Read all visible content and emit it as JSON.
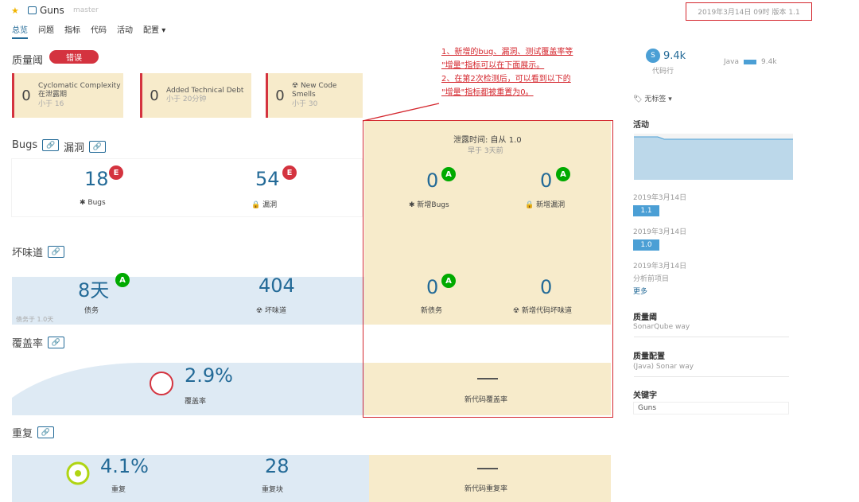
{
  "header": {
    "project": "Guns",
    "branch": "master",
    "date_version": "2019年3月14日 09时 版本 1.1"
  },
  "nav": {
    "tabs": [
      "总览",
      "问题",
      "指标",
      "代码",
      "活动",
      "配置"
    ]
  },
  "quality_gate": {
    "title": "质量阈",
    "status": "错误",
    "conditions": [
      {
        "value": "0",
        "name": "Cyclomatic Complexity",
        "name2": "在泄露期",
        "threshold": "小于 16"
      },
      {
        "value": "0",
        "name": "Added Technical Debt",
        "name2": "",
        "threshold": "小于 20分钟"
      },
      {
        "value": "0",
        "name": "New Code Smells",
        "name2": "",
        "threshold": "小于 30"
      }
    ]
  },
  "annotation": {
    "line1": "1、新增的bug、漏洞、测试覆盖率等",
    "line2": "\"增量\"指标可以在下面展示。",
    "line3": "2、在第2次检测后，可以看到以下的",
    "line4": "\"增量\"指标都被重置为0。"
  },
  "leak": {
    "title": "泄露时间: 自从 1.0",
    "subtitle": "早于 3天前"
  },
  "bugs_section": {
    "title": "Bugs",
    "title2": "漏洞",
    "bugs_value": "18",
    "bugs_rating": "E",
    "bugs_label": "Bugs",
    "vuln_value": "54",
    "vuln_rating": "E",
    "vuln_label": "漏洞",
    "new_bugs_value": "0",
    "new_bugs_rating": "A",
    "new_bugs_label": "新增Bugs",
    "new_vuln_value": "0",
    "new_vuln_rating": "A",
    "new_vuln_label": "新增漏洞"
  },
  "smells_section": {
    "title": "坏味道",
    "debt_value": "8天",
    "debt_rating": "A",
    "debt_label": "债务",
    "debt_note": "债务于 1.0天",
    "smells_value": "404",
    "smells_label": "坏味道",
    "new_debt_value": "0",
    "new_debt_rating": "A",
    "new_debt_label": "新债务",
    "new_smells_value": "0",
    "new_smells_label": "新增代码坏味道"
  },
  "coverage_section": {
    "title": "覆盖率",
    "coverage_value": "2.9%",
    "coverage_label": "覆盖率",
    "new_coverage_value": "—",
    "new_coverage_label": "新代码覆盖率"
  },
  "dup_section": {
    "title": "重复",
    "dup_value": "4.1%",
    "dup_label": "重复",
    "blocks_value": "28",
    "blocks_label": "重复块",
    "new_dup_value": "—",
    "new_dup_label": "新代码重复率"
  },
  "sidebar": {
    "size_letter": "S",
    "loc": "9.4k",
    "loc_label": "代码行",
    "lang_name": "Java",
    "lang_loc": "9.4k",
    "tags": "无标签",
    "activity_title": "活动",
    "events": [
      {
        "date": "2019年3月14日",
        "tag": "1.1"
      },
      {
        "date": "2019年3月14日",
        "tag": "1.0"
      },
      {
        "date": "2019年3月14日",
        "tag": "分析前项目"
      }
    ],
    "more": "更多",
    "qg_title": "质量阈",
    "qg_value": "SonarQube way",
    "qp_title": "质量配置",
    "qp_value": "(Java) Sonar way",
    "key_title": "关键字",
    "key_value": "Guns"
  },
  "colors": {
    "error_red": "#d4333f",
    "rating_A": "#00aa00",
    "link_blue": "#236a97",
    "leak_bg": "#f7ebcb",
    "chart_fill": "#bcd8ea"
  }
}
